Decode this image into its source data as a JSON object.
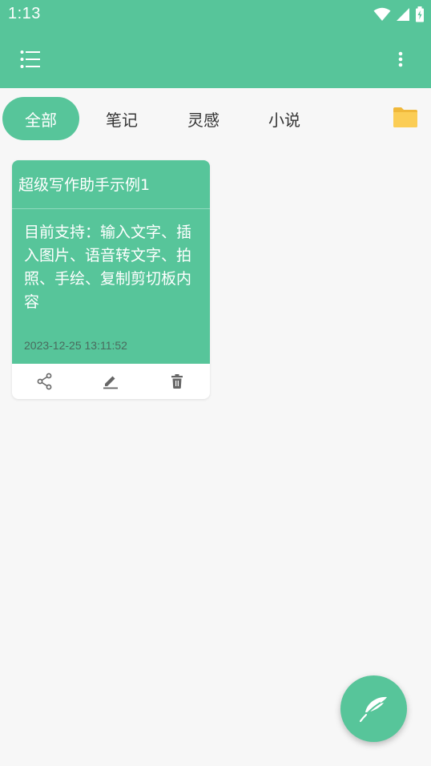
{
  "status_bar": {
    "time": "1:13"
  },
  "app_bar": {
    "menu_icon": "list-menu-icon",
    "overflow_icon": "more-vert-icon"
  },
  "tabs": [
    {
      "label": "全部",
      "selected": true
    },
    {
      "label": "笔记",
      "selected": false
    },
    {
      "label": "灵感",
      "selected": false
    },
    {
      "label": "小说",
      "selected": false
    }
  ],
  "folder_icon": "folder-icon",
  "notes": [
    {
      "title": "超级写作助手示例1",
      "content": "目前支持：输入文字、插入图片、语音转文字、拍照、手绘、复制剪切板内容",
      "date": "2023-12-25 13:11:52",
      "actions": [
        "share-icon",
        "edit-icon",
        "delete-icon"
      ]
    }
  ],
  "fab_icon": "feather-icon",
  "colors": {
    "primary": "#57c59a",
    "background": "#f7f7f7",
    "folder": "#fbcd55"
  }
}
